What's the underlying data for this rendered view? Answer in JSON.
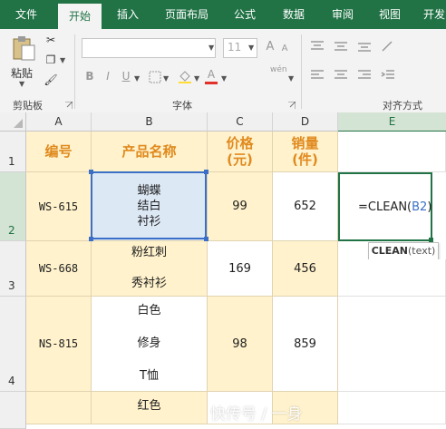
{
  "tabs": [
    "文件",
    "开始",
    "插入",
    "页面布局",
    "公式",
    "数据",
    "审阅",
    "视图",
    "开发"
  ],
  "ribbon": {
    "paste_label": "粘贴",
    "clipboard_label": "剪贴板",
    "font_label": "字体",
    "align_label": "对齐方式",
    "font_size": "11",
    "bold": "B",
    "italic": "I",
    "underline": "U",
    "grow_font": "A",
    "shrink_font": "A",
    "font_color": "A",
    "wen": "wén"
  },
  "columns": [
    "A",
    "B",
    "C",
    "D",
    "E"
  ],
  "rows": [
    "1",
    "2",
    "3",
    "4"
  ],
  "cells": {
    "a1": "编号",
    "b1": "产品名称",
    "c1": [
      "价格",
      "(元)"
    ],
    "d1": [
      "销量",
      "(件)"
    ],
    "a2": "WS-615",
    "b2": [
      "蝴蝶",
      "结白",
      "衬衫"
    ],
    "c2": "99",
    "d2": "652",
    "e2_formula": "=CLEAN(",
    "e2_ref": "B2",
    "e2_close": ")",
    "a3": "WS-668",
    "b3": [
      "粉红刺",
      "秀衬衫"
    ],
    "c3": "169",
    "d3": "456",
    "a4": "NS-815",
    "b4": [
      "白色",
      "修身",
      "T恤"
    ],
    "c4": "98",
    "d4": "859",
    "b5_partial": "红色"
  },
  "tooltip": {
    "fn": "CLEAN",
    "arg": "(text)"
  },
  "watermark": "快传号 / 一身",
  "colors": {
    "accent": "#217346",
    "header_text": "#e08a1e",
    "yellow_fill": "#fff2cc",
    "ref_blue": "#3b6fc7"
  }
}
